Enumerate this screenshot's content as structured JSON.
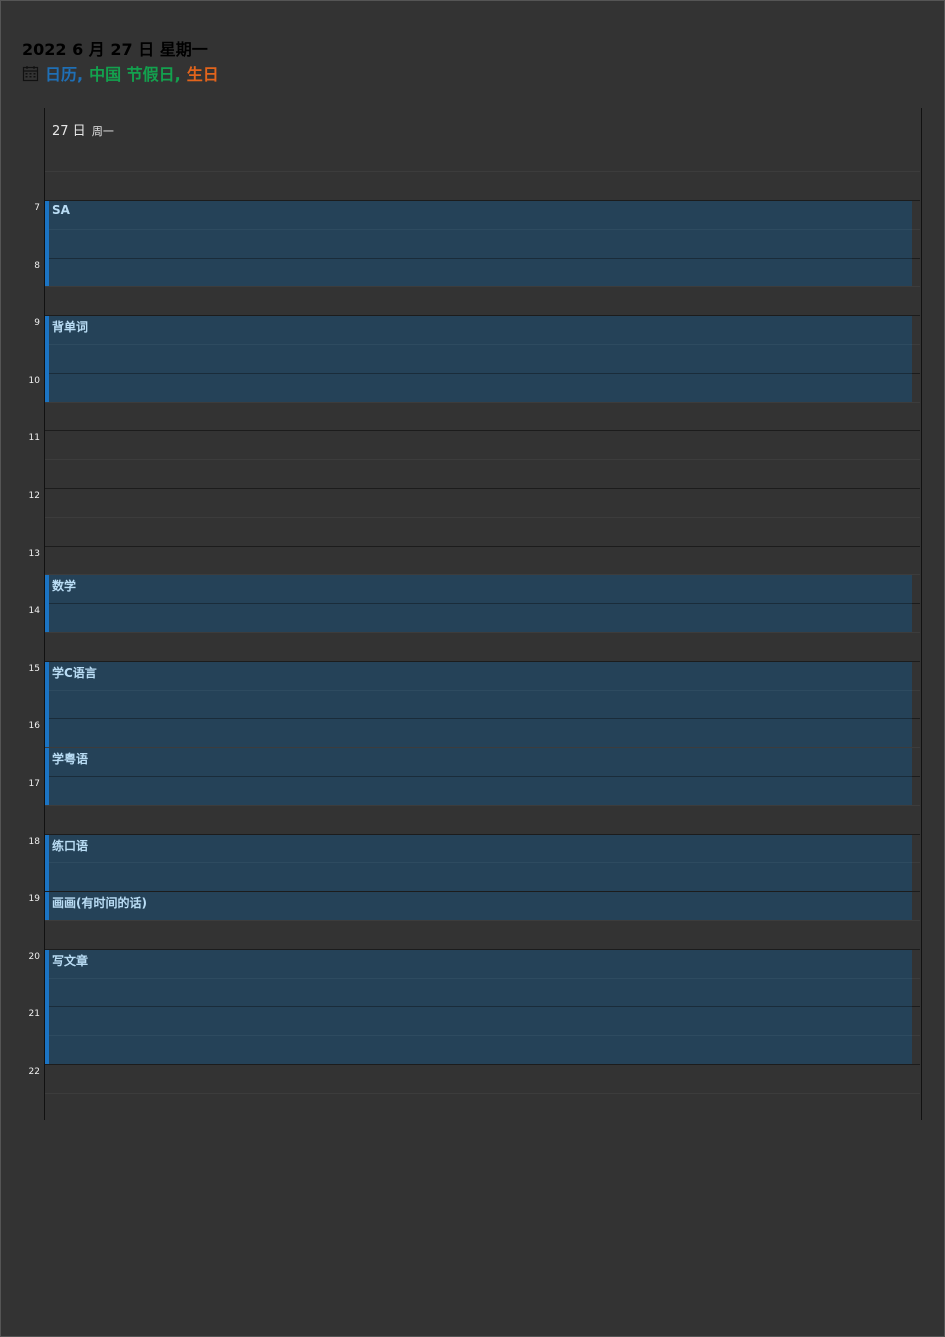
{
  "header": {
    "date_title": "2022 6 月 27 日 星期一",
    "calendar_icon": "calendar-icon",
    "calendars": [
      {
        "label": "日历,",
        "color": "#1f6fb5"
      },
      {
        "label": "中国 节假日,",
        "color": "#13a14e"
      },
      {
        "label": "生日",
        "color": "#e2641c"
      }
    ]
  },
  "day_column": {
    "date": "27 日",
    "weekday": "周一"
  },
  "hours": [
    "7",
    "8",
    "9",
    "10",
    "11",
    "12",
    "13",
    "14",
    "15",
    "16",
    "17",
    "18",
    "19",
    "20",
    "21",
    "22"
  ],
  "events": [
    {
      "title": "SA",
      "start": "7:00",
      "end": "8:30"
    },
    {
      "title": "背单词",
      "start": "9:00",
      "end": "10:30"
    },
    {
      "title": "数学",
      "start": "13:30",
      "end": "14:30"
    },
    {
      "title": "学C语言",
      "start": "15:00",
      "end": "16:30"
    },
    {
      "title": "学粤语",
      "start": "16:30",
      "end": "17:30"
    },
    {
      "title": "练口语",
      "start": "18:00",
      "end": "19:00"
    },
    {
      "title": "画画(有时间的话)",
      "start": "19:00",
      "end": "19:30"
    },
    {
      "title": "写文章",
      "start": "20:00",
      "end": "22:00"
    }
  ],
  "colors": {
    "background": "#333333",
    "event_fill": "#254258",
    "event_accent": "#1b74c4",
    "event_text": "#b9dcf4"
  }
}
